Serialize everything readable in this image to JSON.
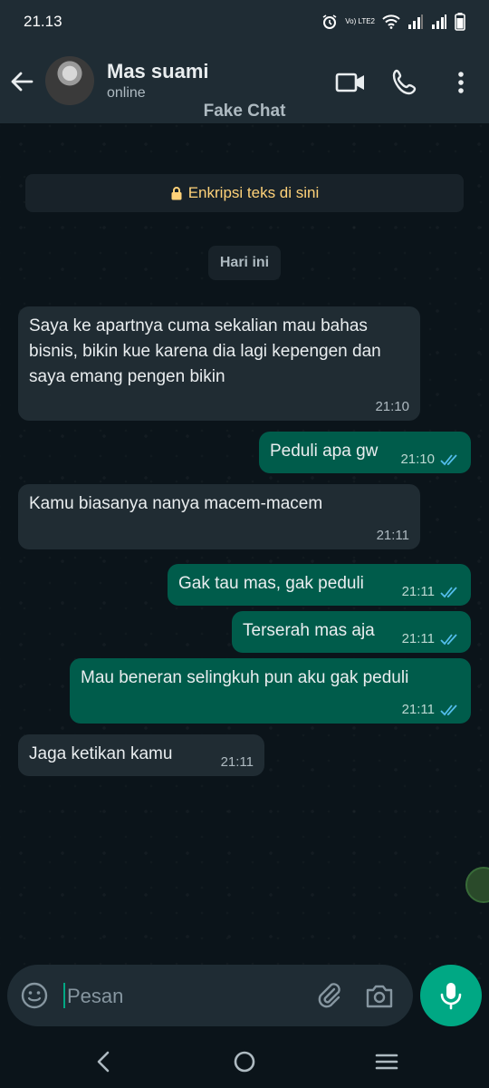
{
  "status_bar": {
    "time": "21.13",
    "network_label": "Vo) LTE2"
  },
  "header": {
    "contact_name": "Mas suami",
    "contact_status": "online",
    "overlay_label": "Fake Chat",
    "icons": [
      "back-arrow-icon",
      "video-call-icon",
      "phone-icon",
      "more-vert-icon"
    ]
  },
  "chat": {
    "encryption_notice": "Enkripsi teks di sini",
    "date_chip": "Hari ini",
    "messages": [
      {
        "dir": "in",
        "text": "Saya ke apartnya cuma sekalian mau bahas bisnis, bikin kue karena dia lagi kepengen dan saya emang pengen bikin",
        "time": "21:10"
      },
      {
        "dir": "out",
        "text": "Peduli apa gw",
        "time": "21:10",
        "read": true
      },
      {
        "dir": "in",
        "text": "Kamu biasanya nanya macem-macem",
        "time": "21:11"
      },
      {
        "dir": "out",
        "text": "Gak tau mas, gak peduli",
        "time": "21:11",
        "read": true
      },
      {
        "dir": "out",
        "text": "Terserah mas aja",
        "time": "21:11",
        "read": true
      },
      {
        "dir": "out",
        "text": "Mau beneran selingkuh pun aku gak peduli",
        "time": "21:11",
        "read": true
      },
      {
        "dir": "in",
        "text": "Jaga ketikan kamu",
        "time": "21:11"
      }
    ]
  },
  "composer": {
    "placeholder": "Pesan"
  },
  "colors": {
    "incoming": "#202c33",
    "outgoing": "#005c4b",
    "accent": "#00a884",
    "read_tick": "#53bdeb"
  }
}
